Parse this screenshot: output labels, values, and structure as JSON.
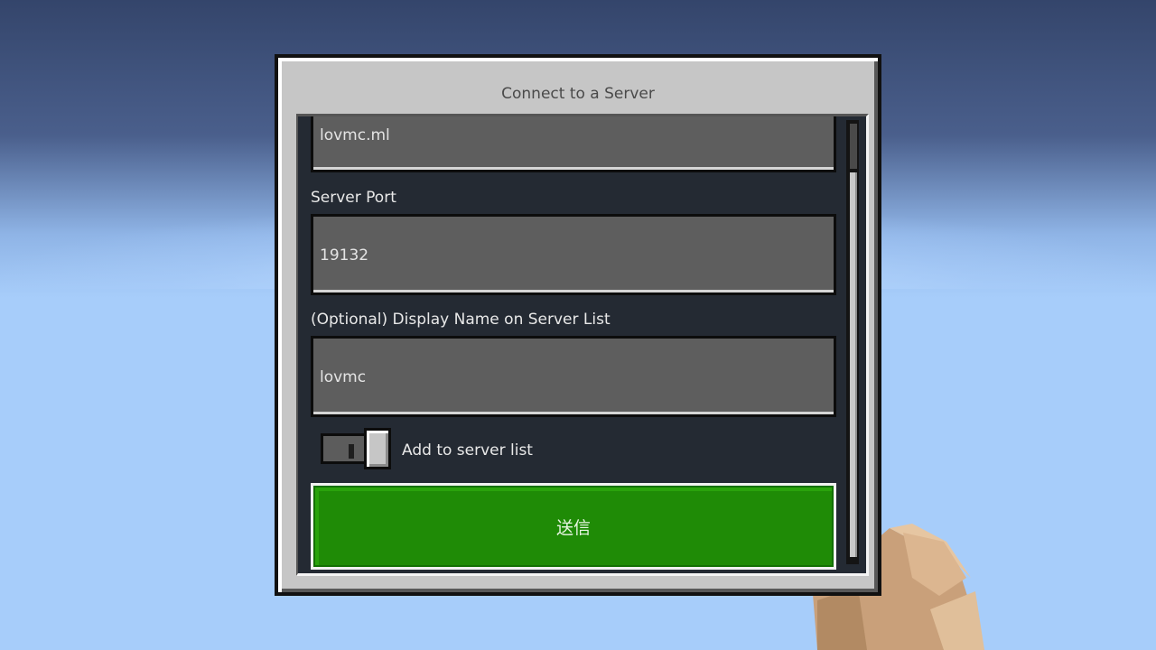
{
  "dialog": {
    "title": "Connect to a Server"
  },
  "form": {
    "server_address_value": "lovmc.ml",
    "port_label": "Server Port",
    "port_value": "19132",
    "display_name_label": "(Optional) Display Name on Server List",
    "display_name_value": "lovmc",
    "add_to_list_label": "Add to server list",
    "add_to_list_enabled": false,
    "submit_label": "送信"
  },
  "colors": {
    "submit_button": "#1f8b06",
    "panel_background": "#242a33",
    "field_background": "#5e5e5e",
    "dialog_frame": "#c6c6c6"
  },
  "icons": {
    "player_hand": "player-hand-icon"
  }
}
